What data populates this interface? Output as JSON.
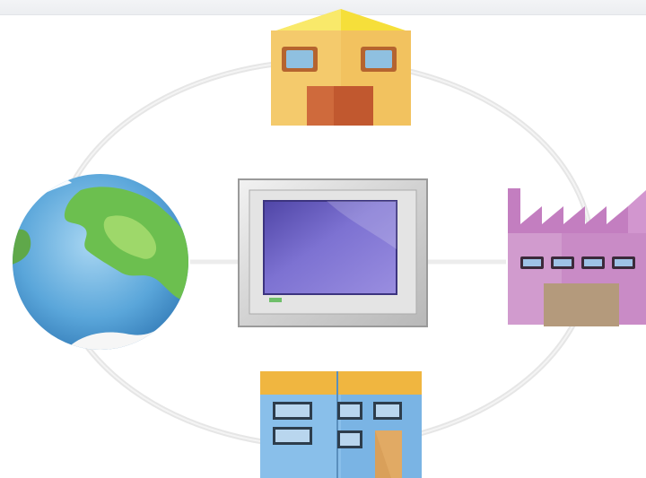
{
  "scene": {
    "colors": {
      "house_wall": "#f2c25f",
      "house_roof": "#f5d94a",
      "house_door": "#c1582f",
      "window_glass": "#8fb8d6",
      "ocean": "#6fb3e0",
      "land": "#77c25a",
      "terminal_frame": "#cfcfcf",
      "terminal_screen": "#6b5fc0",
      "factory_wall": "#c888c4",
      "factory_door": "#b49a7c",
      "office_wall": "#7ab4e4",
      "office_roof": "#f0b640",
      "office_door": "#d9a05a"
    },
    "icons": [
      "house-icon",
      "globe-icon",
      "touch-panel-icon",
      "factory-icon",
      "office-building-icon"
    ]
  }
}
